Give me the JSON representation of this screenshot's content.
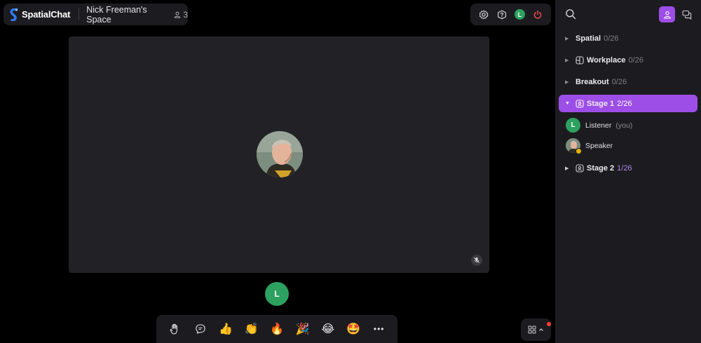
{
  "brand": {
    "name": "SpatialChat"
  },
  "space": {
    "name": "Nick Freeman's Space",
    "participant_count": "3"
  },
  "controls": [
    {
      "name": "settings-icon"
    },
    {
      "name": "help-icon"
    },
    {
      "name": "user-avatar",
      "initial": "L"
    },
    {
      "name": "power-icon"
    }
  ],
  "stage": {
    "speaker_mic": "muted"
  },
  "self": {
    "initial": "L"
  },
  "reactions": [
    {
      "icon": "raise-hand-icon",
      "glyph": "✋"
    },
    {
      "icon": "chat-bubble-icon",
      "glyph": ""
    },
    {
      "icon": "thumbs-up-icon",
      "glyph": "👍"
    },
    {
      "icon": "clap-icon",
      "glyph": "👏"
    },
    {
      "icon": "fire-icon",
      "glyph": "🔥"
    },
    {
      "icon": "party-icon",
      "glyph": "🎉"
    },
    {
      "icon": "laugh-icon",
      "glyph": "😂"
    },
    {
      "icon": "star-eyes-icon",
      "glyph": "🤩"
    },
    {
      "icon": "more-icon",
      "glyph": "•••"
    }
  ],
  "sidebar": {
    "rooms": [
      {
        "name": "Spatial",
        "count": "0/26",
        "expanded": false,
        "icon": ""
      },
      {
        "name": "Workplace",
        "count": "0/26",
        "expanded": false,
        "icon": "workplace-icon"
      },
      {
        "name": "Breakout",
        "count": "0/26",
        "expanded": false,
        "icon": ""
      },
      {
        "name": "Stage 1",
        "count": "2/26",
        "expanded": true,
        "icon": "stage-icon",
        "active": true
      },
      {
        "name": "Stage 2",
        "count": "1/26",
        "expanded": false,
        "icon": "stage-icon"
      }
    ],
    "members": [
      {
        "name": "Listener",
        "suffix": "(you)",
        "initial": "L",
        "color": "#2da160"
      },
      {
        "name": "Speaker",
        "suffix": "",
        "initial": "",
        "color": "#6d7e70"
      }
    ]
  },
  "colors": {
    "accent": "#9d4ee6",
    "avatar_green": "#2da160",
    "power_red": "#ff4d4d"
  }
}
